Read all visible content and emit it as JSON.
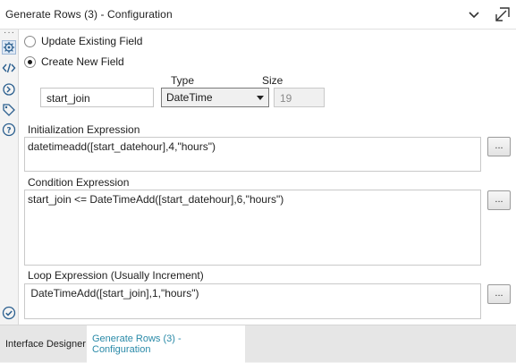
{
  "window": {
    "title": "Generate Rows (3) - Configuration"
  },
  "options": {
    "update_existing": "Update Existing Field",
    "create_new": "Create New  Field",
    "selected": "create_new"
  },
  "field": {
    "name_value": "start_join",
    "type_label": "Type",
    "type_value": "DateTime",
    "size_label": "Size",
    "size_value": "19"
  },
  "init_expr": {
    "label": "Initialization Expression",
    "value": "datetimeadd([start_datehour],4,\"hours\")",
    "button": "..."
  },
  "cond_expr": {
    "label": "Condition Expression",
    "value": "start_join <= DateTimeAdd([start_datehour],6,\"hours\")",
    "button": "..."
  },
  "loop_expr": {
    "label": "Loop Expression (Usually Increment)",
    "value": " DateTimeAdd([start_join],1,\"hours\")",
    "button": "..."
  },
  "tabs": [
    {
      "label": "Interface Designer",
      "active": false
    },
    {
      "label": "Generate Rows (3) - Configuration",
      "active": true
    }
  ],
  "colors": {
    "accent": "#2a8aa8",
    "icon": "#2b5f8f"
  },
  "icons": [
    "chevron-down-icon",
    "undock-icon",
    "gear-icon",
    "code-icon",
    "connect-icon",
    "tag-icon",
    "help-icon",
    "check-circle-icon"
  ]
}
